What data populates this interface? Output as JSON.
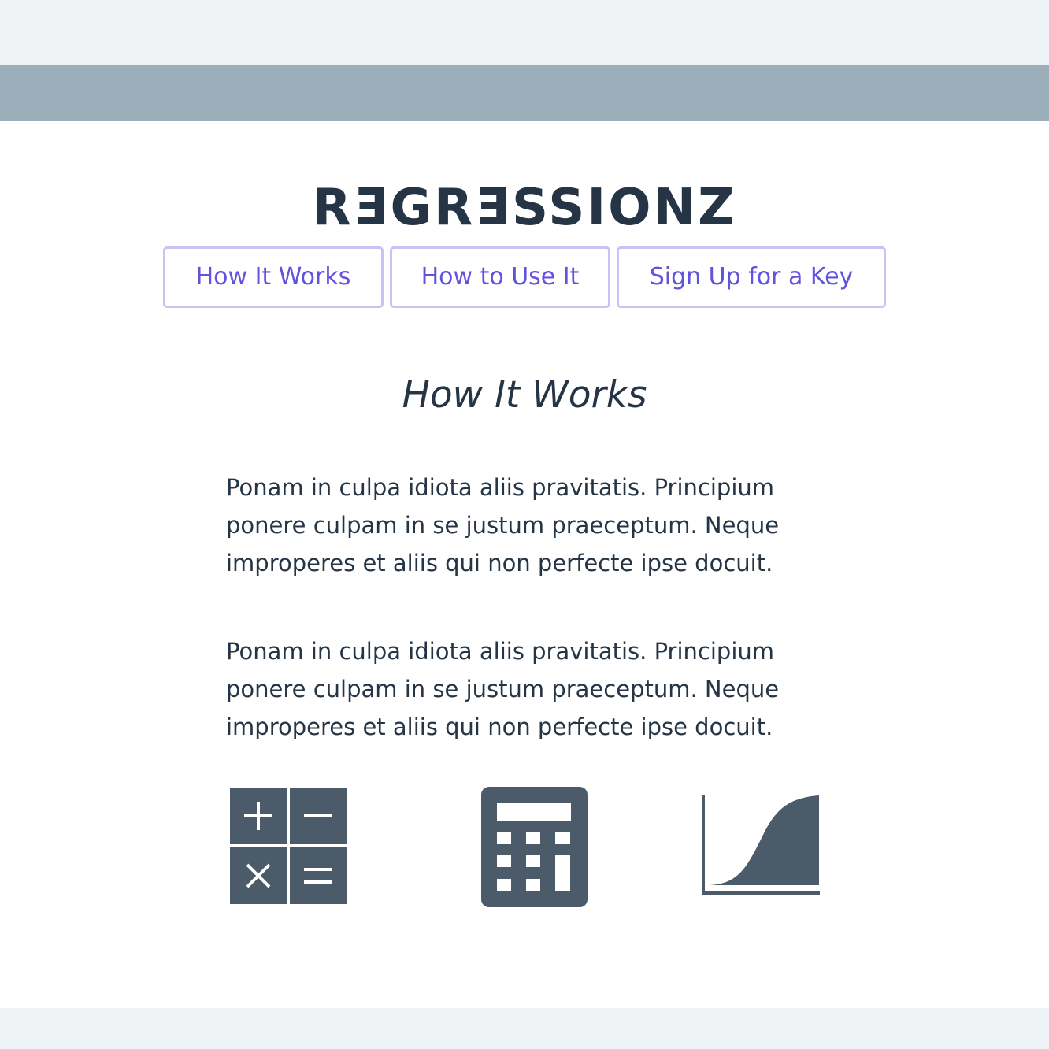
{
  "header": {
    "logo_text": "RƎGRƎSSIONZ"
  },
  "nav": {
    "items": [
      {
        "label": "How It Works"
      },
      {
        "label": "How to Use It"
      },
      {
        "label": "Sign Up for a Key"
      }
    ]
  },
  "section": {
    "title": "How It Works",
    "paragraphs": [
      "Ponam in culpa idiota aliis pravitatis. Principium\nponere culpam in se justum praeceptum. Neque\nimproperes et aliis qui non perfecte ipse docuit.",
      "Ponam in culpa idiota aliis pravitatis. Principium\nponere culpam in se justum praeceptum. Neque\nimproperes et aliis qui non perfecte ipse docuit."
    ]
  },
  "icons": [
    {
      "name": "math-operations-icon"
    },
    {
      "name": "calculator-icon"
    },
    {
      "name": "growth-curve-icon"
    }
  ],
  "colors": {
    "top_bar": "#9daebb",
    "page_background": "#eff3f6",
    "content_background": "#ffffff",
    "text": "#263545",
    "accent": "#6352de",
    "button_border": "#c9c2f4",
    "icon": "#4b5b6a"
  }
}
